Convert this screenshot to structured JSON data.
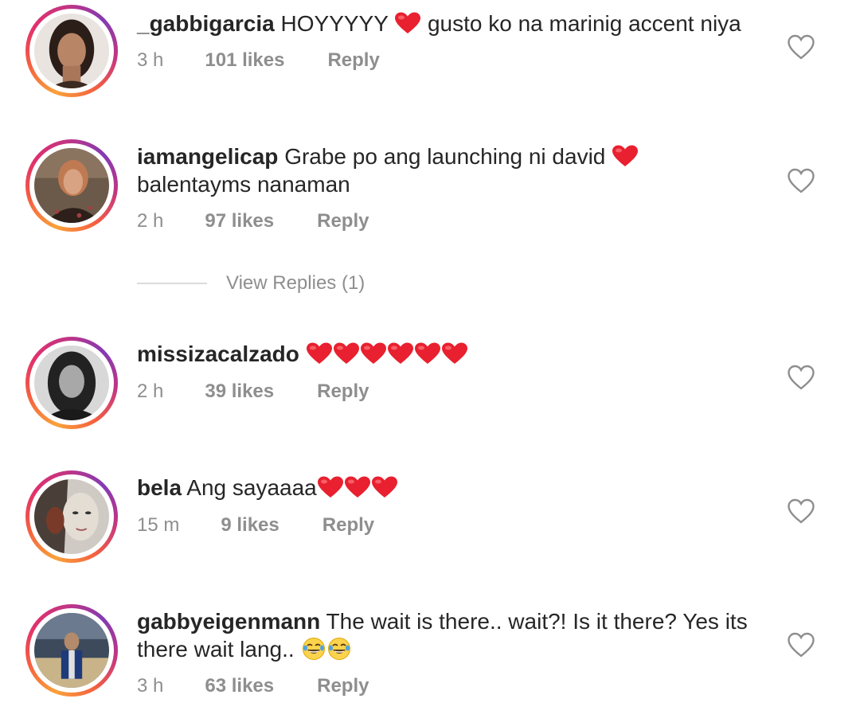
{
  "comments": [
    {
      "username": "_gabbigarcia",
      "text_before": "HOYYYYY",
      "text_after": "gusto ko na marinig accent niya",
      "time": "3 h",
      "likes": "101 likes",
      "reply": "Reply"
    },
    {
      "username": "iamangelicap",
      "text_before": "Grabe po ang launching ni david",
      "text_line2": "balentayms nanaman",
      "time": "2 h",
      "likes": "97 likes",
      "reply": "Reply"
    },
    {
      "username": "missizacalzado",
      "time": "2 h",
      "likes": "39 likes",
      "reply": "Reply"
    },
    {
      "username": "bela",
      "text_before": "Ang sayaaaa",
      "time": "15 m",
      "likes": "9 likes",
      "reply": "Reply"
    },
    {
      "username": "gabbyeigenmann",
      "text_before": "The wait is there.. wait?! Is it there? Yes its",
      "text_line2": "there wait lang..",
      "time": "3 h",
      "likes": "63 likes",
      "reply": "Reply"
    }
  ],
  "view_replies": "View Replies (1)",
  "icons": {
    "like": "heart-outline-icon",
    "heart_emoji": "red-heart-emoji",
    "laugh_emoji": "laughing-tears-emoji"
  },
  "colors": {
    "text": "#262626",
    "secondary": "#8e8e8e",
    "heart": "#e8202f",
    "divider": "#dbdbdb"
  }
}
